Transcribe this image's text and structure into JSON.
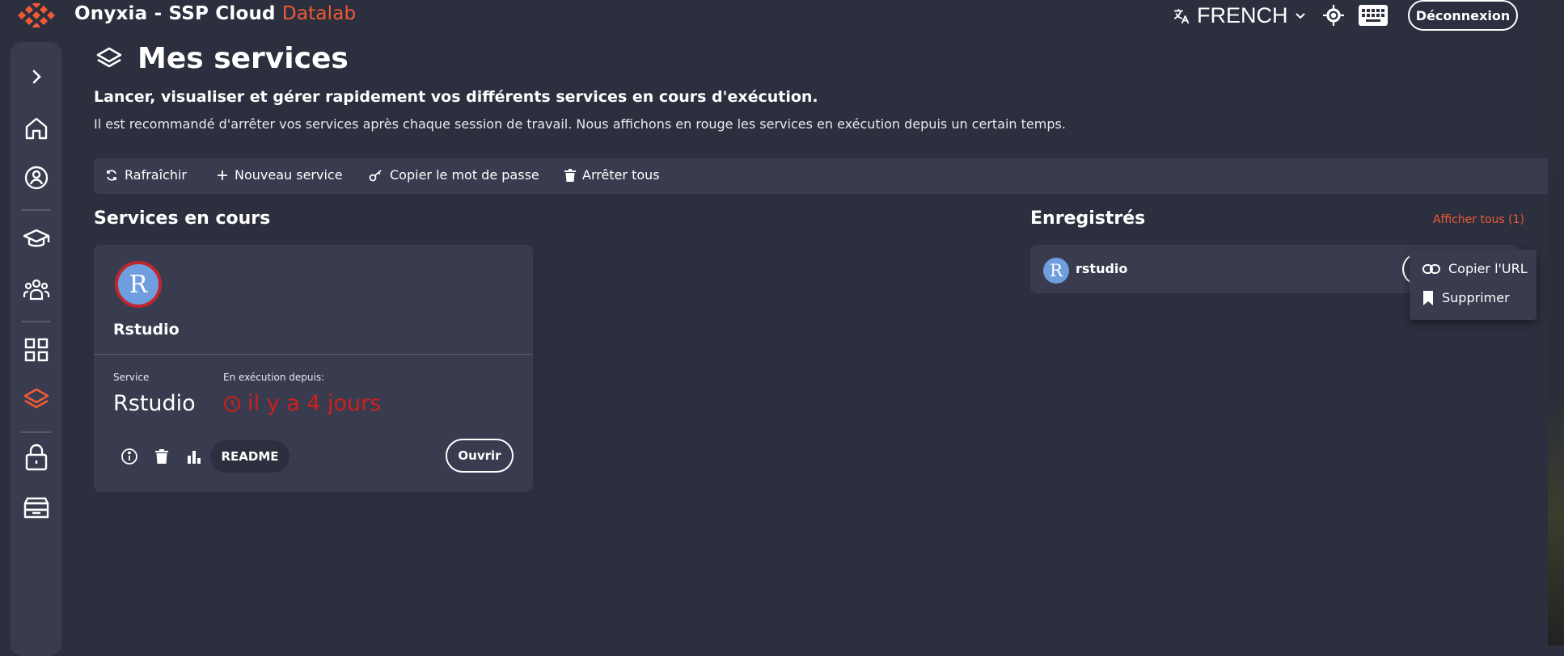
{
  "app": {
    "title": "Onyxia - SSP Cloud",
    "title_accent": "Datalab",
    "accent_color": "#f15a35"
  },
  "header": {
    "language": "FRENCH",
    "logout_label": "Déconnexion"
  },
  "page": {
    "title": "Mes services",
    "subtitle": "Lancer, visualiser et gérer rapidement vos différents services en cours d'exécution.",
    "help": "Il est recommandé d'arrêter vos services après chaque session de travail. Nous affichons en rouge les services en exécution depuis un certain temps."
  },
  "toolbar": {
    "refresh": "Rafraîchir",
    "new_service": "Nouveau service",
    "copy_password": "Copier le mot de passe",
    "stop_all": "Arrêter tous"
  },
  "running": {
    "section_title": "Services en cours",
    "card": {
      "avatar_letter": "R",
      "name": "Rstudio",
      "service_label": "Service",
      "service_value": "Rstudio",
      "running_label": "En exécution depuis:",
      "running_value": "il y a 4 jours",
      "readme": "README",
      "open": "Ouvrir"
    }
  },
  "saved": {
    "section_title": "Enregistrés",
    "show_all": "Afficher tous (1)",
    "item": {
      "avatar_letter": "R",
      "label": "rstudio"
    },
    "menu": {
      "copy_url": "Copier l'URL",
      "delete": "Supprimer"
    }
  },
  "sidebar": {
    "icons": [
      "chevron-right-icon",
      "home-icon",
      "account-icon",
      "catalog-icon",
      "community-icon",
      "apps-icon",
      "services-icon",
      "secrets-icon",
      "storage-icon"
    ],
    "active": "services-icon"
  }
}
